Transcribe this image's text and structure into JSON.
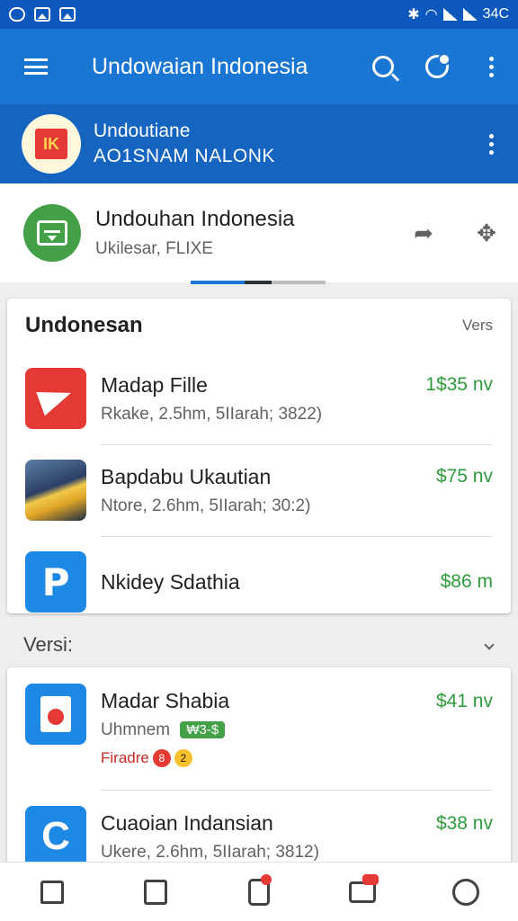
{
  "status_bar": {
    "time": "34C"
  },
  "app_bar": {
    "title": "Undowaian Indonesia",
    "icons": [
      "menu-icon",
      "search-icon",
      "profile-icon",
      "more-vert-icon"
    ]
  },
  "account": {
    "name": "Undoutiane",
    "subtitle": "AO1SNAM NALONK",
    "logo_text": "IK"
  },
  "app_header": {
    "title": "Undouhan Indonesia",
    "subtitle": "Ukilesar, FLIXE"
  },
  "section1": {
    "title": "Undonesan",
    "link": "Vers",
    "items": [
      {
        "title": "Madap Fille",
        "subtitle": "Rkake, 2.5hm, 5IIarah; 3822)",
        "price": "1$35 nv",
        "icon": "paper-plane-icon"
      },
      {
        "title": "Bapdabu Ukautian",
        "subtitle": "Ntore, 2.6hm, 5IIarah; 30:2)",
        "price": "$75 nv",
        "icon": "photo-thumbnail"
      },
      {
        "title": "Nkidey Sdathia",
        "subtitle": "",
        "price": "$86 m",
        "icon": "p-letter-icon",
        "icon_text": "P"
      }
    ]
  },
  "section2": {
    "title": "Versi:",
    "items": [
      {
        "title": "Madar Shabia",
        "subtitle": "Uhmnem",
        "badge": "₩3-$",
        "meta": "Firadre",
        "meta_badge1": "8",
        "meta_badge2": "2",
        "price": "$41 nv",
        "icon": "house-icon"
      },
      {
        "title": "Cuaoian Indansian",
        "subtitle": "Ukere, 2.6hm, 5IIarah; 3812)",
        "price": "$38 nv",
        "icon": "c-letter-icon",
        "icon_text": "C"
      }
    ]
  },
  "bottom_nav": [
    "home-icon",
    "document-icon",
    "phone-icon",
    "chat-icon",
    "user-icon"
  ],
  "colors": {
    "primary": "#1976d2",
    "primary_dark": "#1565c0",
    "price": "#2e9b3c",
    "accent_red": "#e53935"
  }
}
